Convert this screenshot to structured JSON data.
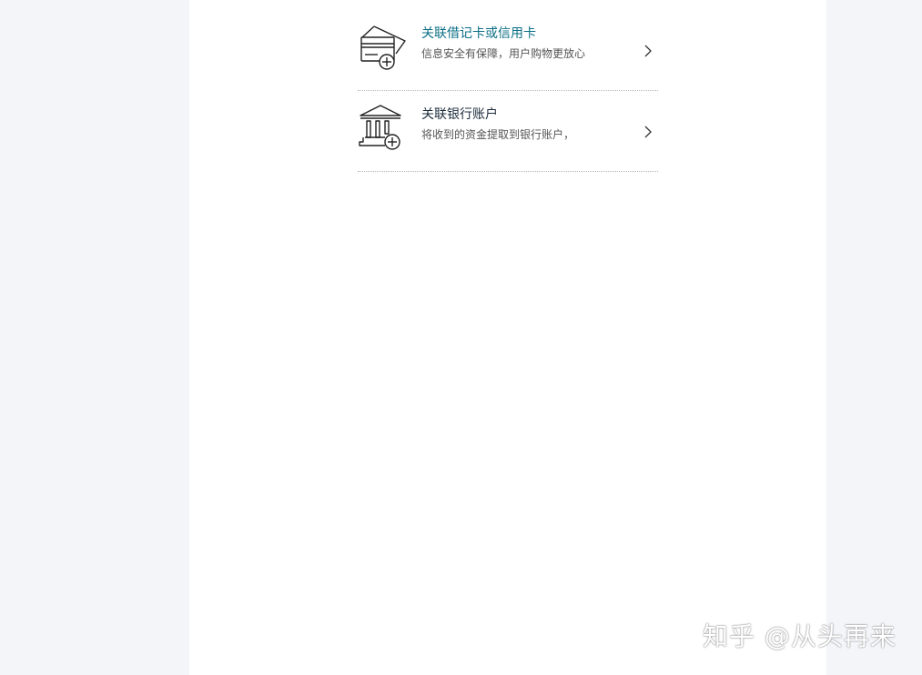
{
  "options": [
    {
      "title": "关联借记卡或信用卡",
      "subtitle": "信息安全有保障，用户购物更放心",
      "icon": "credit-card-add-icon"
    },
    {
      "title": "关联银行账户",
      "subtitle": "将收到的资金提取到银行账户，",
      "icon": "bank-add-icon"
    }
  ],
  "watermark": "知乎 @从头再来",
  "colors": {
    "link_title": "#0b6f86",
    "plain_title": "#1d2c3c",
    "side_background": "#f4f5f9"
  }
}
